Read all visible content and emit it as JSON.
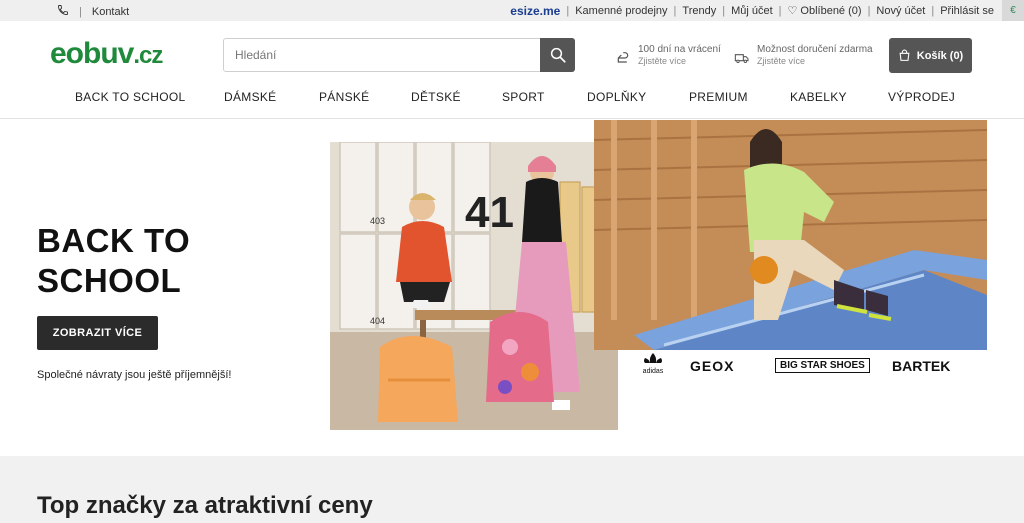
{
  "topbar": {
    "contact": "Kontakt",
    "esize": "esize.me",
    "links": [
      "Kamenné prodejny",
      "Trendy",
      "Můj účet",
      "Oblíbené (0)",
      "Nový účet",
      "Přihlásit se"
    ],
    "currency": "€"
  },
  "header": {
    "logo_main": "eobuv",
    "logo_tld": ".cz",
    "search_placeholder": "Hledání",
    "returns_title": "100 dní na vrácení",
    "returns_sub": "Zjistěte více",
    "delivery_title": "Možnost doručení zdarma",
    "delivery_sub": "Zjistěte více",
    "cart_label": "Košík (0)"
  },
  "nav": {
    "items": [
      "BACK TO SCHOOL",
      "DÁMSKÉ",
      "PÁNSKÉ",
      "DĚTSKÉ",
      "SPORT",
      "DOPLŇKY",
      "PREMIUM",
      "KABELKY",
      "VÝPRODEJ"
    ]
  },
  "hero": {
    "title_line1": "BACK TO",
    "title_line2": "SCHOOL",
    "button": "ZOBRAZIT VÍCE",
    "subtitle": "Společné návraty jsou ještě příjemnější!",
    "brands": [
      "adidas",
      "GEOX",
      "BIG STAR SHOES",
      "BARTEK"
    ]
  },
  "section": {
    "title": "Top značky za atraktivní ceny"
  },
  "colors": {
    "brand_green": "#1f8a3b",
    "dark_button": "#2b2b2b",
    "header_button": "#555555"
  }
}
